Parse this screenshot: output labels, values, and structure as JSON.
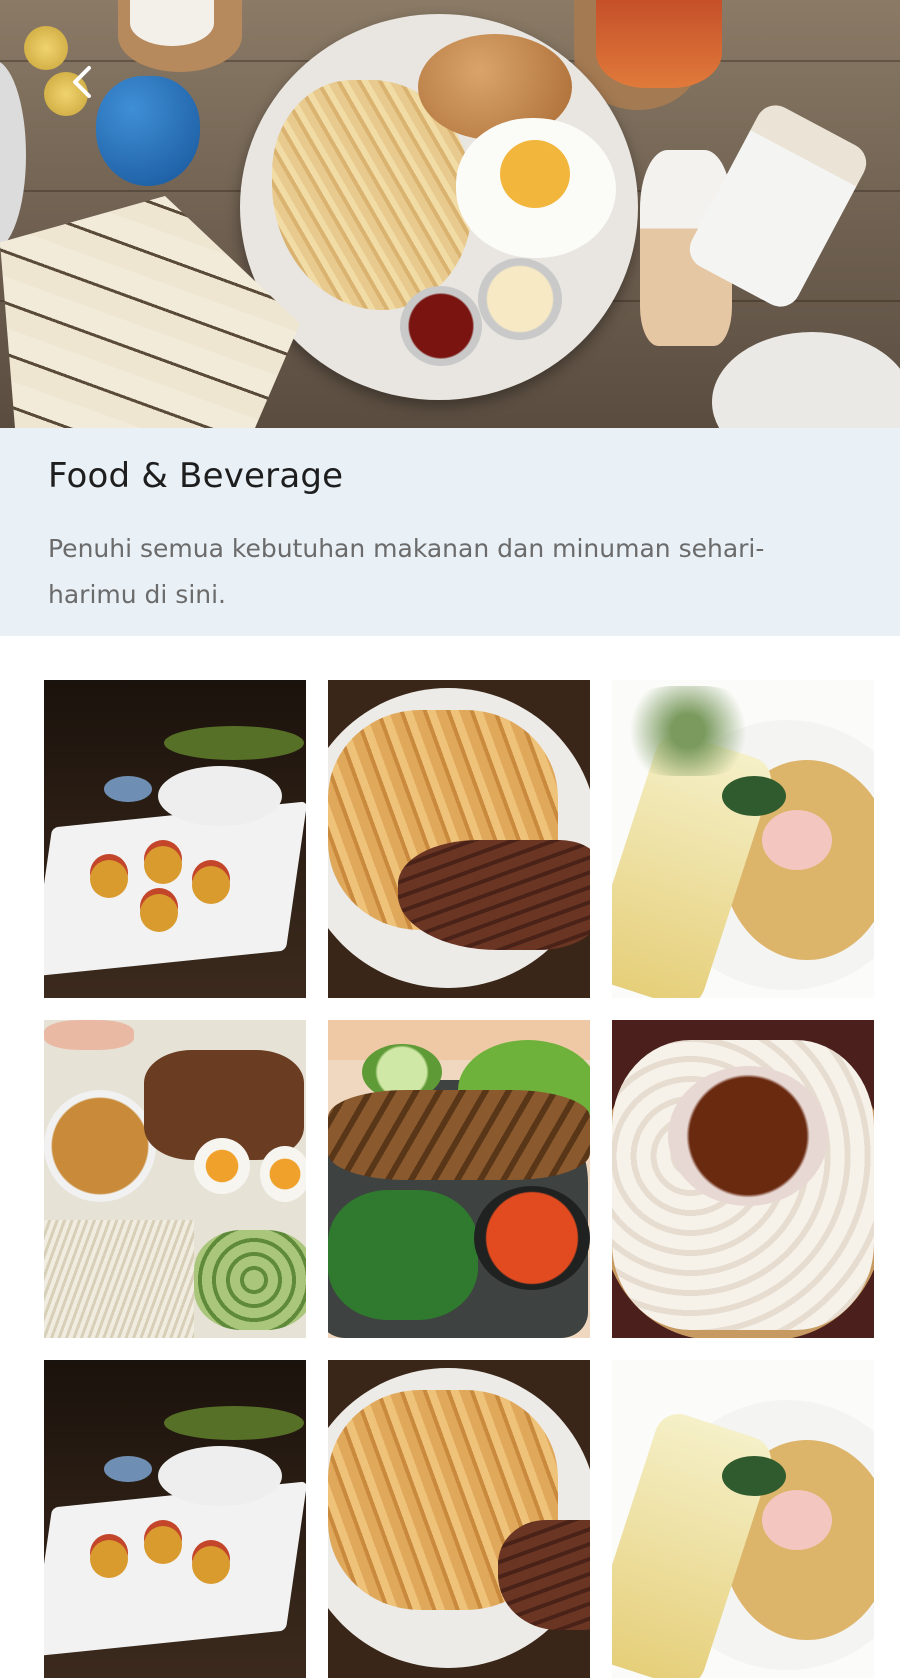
{
  "header": {
    "back_icon": "chevron-left-icon"
  },
  "category": {
    "title": "Food & Beverage",
    "description": "Penuhi semua kebutuhan makanan dan minuman sehari-harimu di sini."
  },
  "gallery": {
    "tiles": [
      {
        "subject": "bruschetta-dark"
      },
      {
        "subject": "fries-steak"
      },
      {
        "subject": "garlic-bread-soup"
      },
      {
        "subject": "gado-gado"
      },
      {
        "subject": "fried-fish-sambal"
      },
      {
        "subject": "rice-crackers-sambal"
      },
      {
        "subject": "bruschetta-dark"
      },
      {
        "subject": "fries-steak"
      },
      {
        "subject": "garlic-bread-soup"
      }
    ]
  },
  "colors": {
    "info_background": "#e9f0f6",
    "title_color": "#1e1e1e",
    "description_color": "#6b6b6b"
  }
}
